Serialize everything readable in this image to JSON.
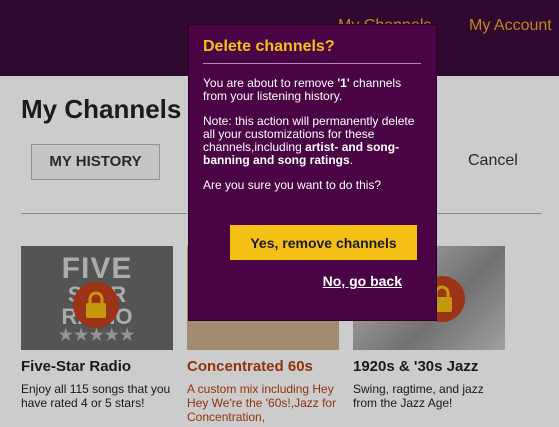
{
  "header": {
    "nav_mychannels": "My Channels",
    "nav_account": "My Account"
  },
  "page": {
    "title": "My Channels",
    "tab_history": "MY HISTORY",
    "cancel": "Cancel"
  },
  "cards": [
    {
      "title": "Five-Star Radio",
      "description": "Enjoy all 115 songs that you have rated 4 or 5 stars!",
      "logo": [
        "FIVE",
        "STAR",
        "RADIO"
      ],
      "stars": "★★★★★"
    },
    {
      "title": "Concentrated 60s",
      "description": "A custom mix including Hey Hey We're the '60s!,Jazz for Concentration,"
    },
    {
      "title": "1920s & '30s Jazz",
      "description": "Swing, ragtime, and jazz from the Jazz Age!"
    }
  ],
  "modal": {
    "title": "Delete channels?",
    "remove_prefix": "You are about to remove ",
    "remove_count": "'1'",
    "remove_suffix": " channels from your listening history.",
    "note_prefix": "Note: this action will permanently delete all your customizations for these channels,including ",
    "note_bold": "artist- and song-banning and song ratings",
    "note_suffix": ".",
    "question": "Are you sure you want to do this?",
    "confirm_label": "Yes, remove channels",
    "cancel_label": "No, go back"
  },
  "colors": {
    "header_bg": "#3a0a3a",
    "accent_gold": "#f0a826",
    "modal_bg": "#4a0445",
    "modal_title": "#f5c016",
    "confirm_bg": "#f5c016",
    "link_orange": "#b34210",
    "lock_badge": "#c4401a"
  },
  "icons": {
    "lock": "lock-icon"
  }
}
